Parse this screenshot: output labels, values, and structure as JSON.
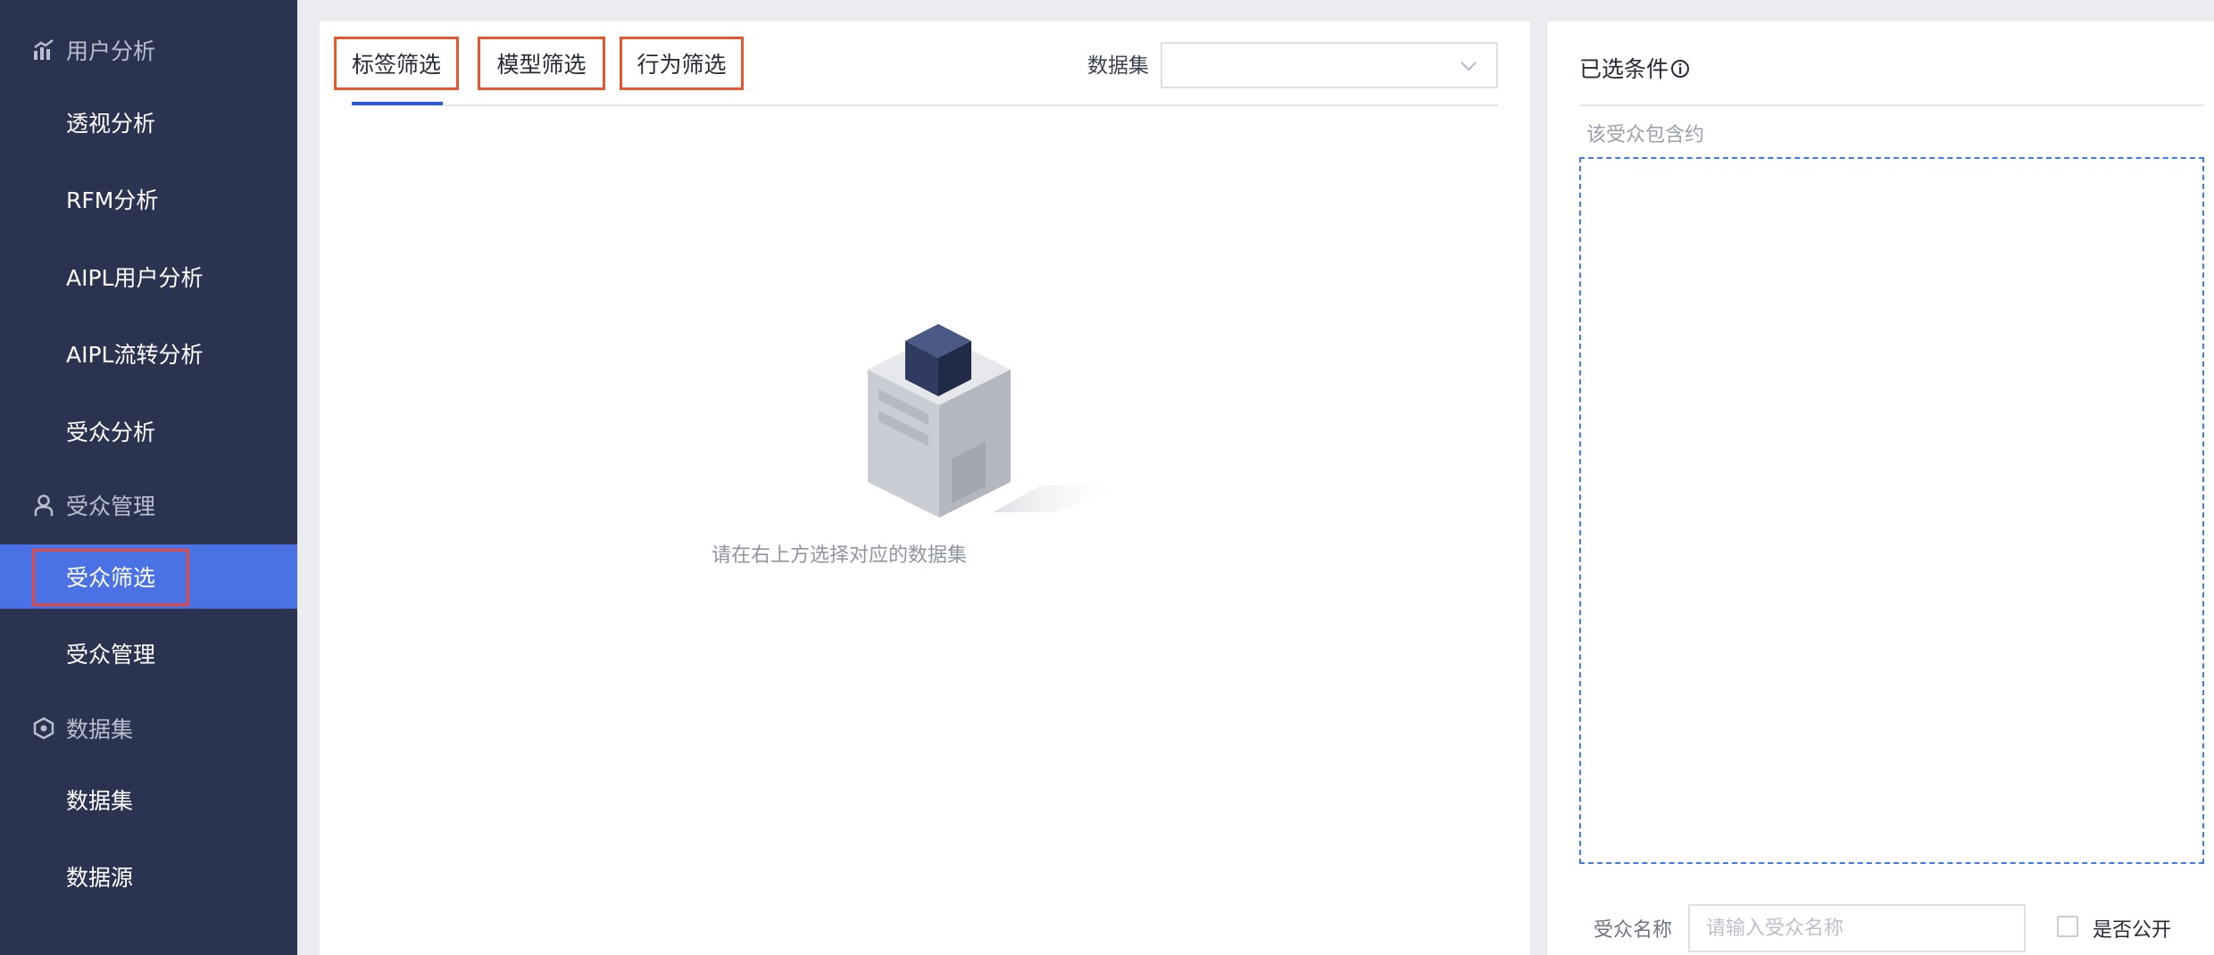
{
  "sidebar": {
    "groups": [
      {
        "label": "用户分析",
        "icon": "chart-icon"
      },
      {
        "label": "受众管理",
        "icon": "user-icon"
      },
      {
        "label": "数据集",
        "icon": "hexagon-icon"
      }
    ],
    "items": [
      {
        "label": "透视分析"
      },
      {
        "label": "RFM分析"
      },
      {
        "label": "AIPL用户分析"
      },
      {
        "label": "AIPL流转分析"
      },
      {
        "label": "受众分析"
      },
      {
        "label": "受众筛选",
        "active": true
      },
      {
        "label": "受众管理"
      },
      {
        "label": "数据集"
      },
      {
        "label": "数据源"
      }
    ]
  },
  "main": {
    "tabs": [
      {
        "label": "标签筛选",
        "active": true
      },
      {
        "label": "模型筛选"
      },
      {
        "label": "行为筛选"
      }
    ],
    "dataset": {
      "label": "数据集",
      "value": ""
    },
    "empty_state": {
      "text": "请在右上方选择对应的数据集"
    }
  },
  "right_panel": {
    "title": "已选条件",
    "contains_label": "该受众包含约",
    "audience_name": {
      "label": "受众名称",
      "placeholder": "请输入受众名称",
      "value": ""
    },
    "public": {
      "label": "是否公开",
      "checked": false
    }
  },
  "colors": {
    "sidebar_bg": "#2a3451",
    "active_item": "#4a72e4",
    "highlight_border": "#e8562f",
    "tab_underline": "#2e5bd9",
    "drop_zone_border": "#3d7bea"
  }
}
